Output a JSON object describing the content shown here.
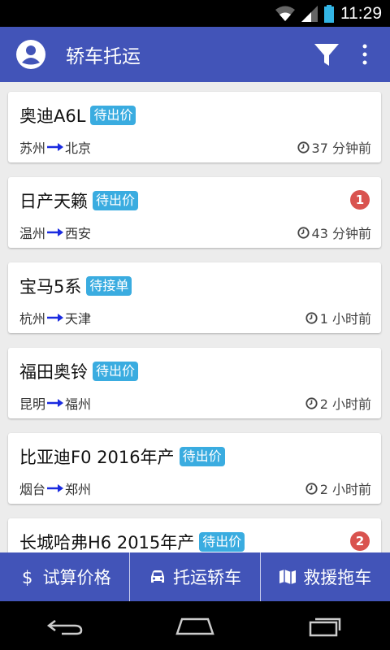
{
  "status_bar": {
    "time": "11:29"
  },
  "app_bar": {
    "title": "轿车托运",
    "icons": [
      "account-icon",
      "filter-icon",
      "more-vert-icon"
    ]
  },
  "orders": [
    {
      "car": "奥迪A6L",
      "status": "待出价",
      "from": "苏州",
      "to": "北京",
      "time": "37 分钟前",
      "count": ""
    },
    {
      "car": "日产天籁",
      "status": "待出价",
      "from": "温州",
      "to": "西安",
      "time": "43 分钟前",
      "count": "1"
    },
    {
      "car": "宝马5系",
      "status": "待接单",
      "from": "杭州",
      "to": "天津",
      "time": "1 小时前",
      "count": ""
    },
    {
      "car": "福田奥铃",
      "status": "待出价",
      "from": "昆明",
      "to": "福州",
      "time": "2 小时前",
      "count": ""
    },
    {
      "car": "比亚迪F0 2016年产",
      "status": "待出价",
      "from": "烟台",
      "to": "郑州",
      "time": "2 小时前",
      "count": ""
    },
    {
      "car": "长城哈弗H6 2015年产",
      "status": "待出价",
      "from": "",
      "to": "",
      "time": "",
      "count": "2"
    }
  ],
  "bottom_bar": {
    "estimate_label": "试算价格",
    "shipping_label": "托运轿车",
    "rescue_label": "救援拖车"
  },
  "colors": {
    "primary": "#4254b8",
    "status_badge": "#3aace0",
    "count_badge": "#d9534f",
    "route_arrow": "#1a2be0"
  }
}
